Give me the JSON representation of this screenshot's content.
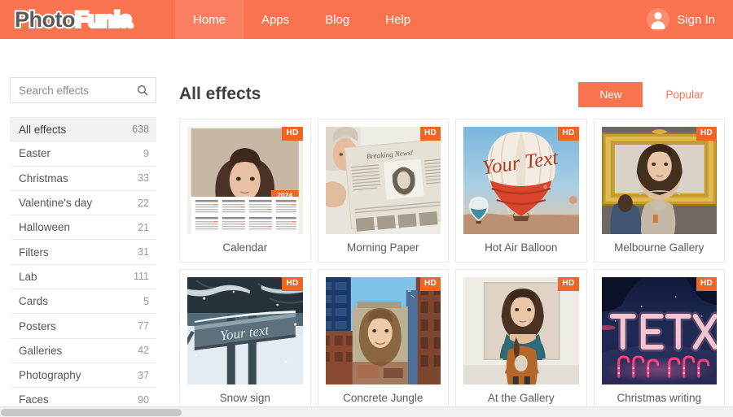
{
  "header": {
    "brand": {
      "part1": "Photo",
      "part2": "Funia"
    },
    "nav": [
      {
        "label": "Home",
        "active": true
      },
      {
        "label": "Apps",
        "active": false
      },
      {
        "label": "Blog",
        "active": false
      },
      {
        "label": "Help",
        "active": false
      }
    ],
    "account": {
      "label": "Sign In",
      "icon": "user-avatar-icon"
    },
    "accent_color": "#f9734e",
    "active_tab_color": "#fb8062"
  },
  "sidebar": {
    "search": {
      "placeholder": "Search effects",
      "value": "",
      "icon": "search-icon"
    },
    "categories": [
      {
        "label": "All effects",
        "count": "638",
        "active": true
      },
      {
        "label": "Easter",
        "count": "9",
        "active": false
      },
      {
        "label": "Christmas",
        "count": "33",
        "active": false
      },
      {
        "label": "Valentine's day",
        "count": "22",
        "active": false
      },
      {
        "label": "Halloween",
        "count": "21",
        "active": false
      },
      {
        "label": "Filters",
        "count": "31",
        "active": false
      },
      {
        "label": "Lab",
        "count": "111",
        "active": false
      },
      {
        "label": "Cards",
        "count": "5",
        "active": false
      },
      {
        "label": "Posters",
        "count": "77",
        "active": false
      },
      {
        "label": "Galleries",
        "count": "42",
        "active": false
      },
      {
        "label": "Photography",
        "count": "37",
        "active": false
      },
      {
        "label": "Faces",
        "count": "90",
        "active": false
      }
    ]
  },
  "main": {
    "title": "All effects",
    "sort": [
      {
        "label": "New",
        "active": true
      },
      {
        "label": "Popular",
        "active": false
      }
    ],
    "badge_label": "HD",
    "effects": [
      {
        "title": "Calendar",
        "hd": "HD",
        "art": "calendar",
        "caption": "2024"
      },
      {
        "title": "Morning Paper",
        "hd": "HD",
        "art": "newspaper",
        "caption": "Breaking News!"
      },
      {
        "title": "Hot Air Balloon",
        "hd": "HD",
        "art": "balloon",
        "caption": "Your Text"
      },
      {
        "title": "Melbourne Gallery",
        "hd": "HD",
        "art": "gallery-frame",
        "caption": ""
      },
      {
        "title": "Snow sign",
        "hd": "HD",
        "art": "snow-sign",
        "caption": "Your text"
      },
      {
        "title": "Concrete Jungle",
        "hd": "HD",
        "art": "concrete-jungle",
        "caption": ""
      },
      {
        "title": "At the Gallery",
        "hd": "HD",
        "art": "at-the-gallery",
        "caption": ""
      },
      {
        "title": "Christmas writing",
        "hd": "HD",
        "art": "christmas-writing",
        "caption": "TEXT"
      }
    ]
  }
}
